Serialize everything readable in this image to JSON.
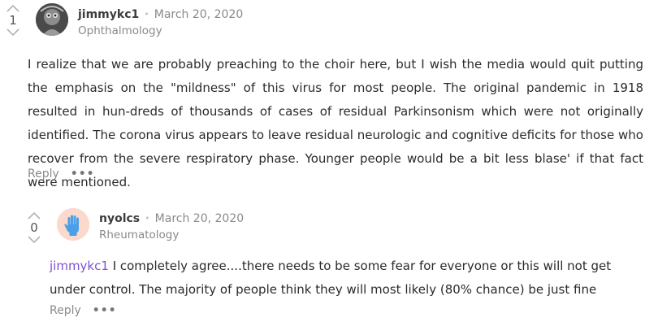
{
  "comments": [
    {
      "votes": "1",
      "author": "jimmykc1",
      "date": "March 20, 2020",
      "specialty": "Ophthalmology",
      "body": "I realize that we are probably preaching to the choir here, but I wish the media would quit putting the emphasis on the \"mildness\" of this virus for most people. The original pandemic in 1918 resulted in hun-dreds of thousands of cases of residual Parkinsonism which were not originally identified. The corona virus appears to leave residual neurologic and cognitive deficits for those who recover from the severe respiratory phase. Younger people would be a bit less blase' if that fact were mentioned.",
      "reply_label": "Reply",
      "more_label": "•••"
    },
    {
      "votes": "0",
      "author": "nyolcs",
      "date": "March 20, 2020",
      "specialty": "Rheumatology",
      "mention": "jimmykc1",
      "body": " I completely agree....there needs to be some fear for everyone or this will not get under control. The majority of people think they will most likely (80% chance) be just fine",
      "reply_label": "Reply",
      "more_label": "•••"
    }
  ],
  "separator": "•",
  "icons": {
    "upvote": "chevron-up-icon",
    "downvote": "chevron-down-icon",
    "avatar1": "avatar-photo",
    "avatar2": "glove-icon"
  },
  "colors": {
    "mention": "#7d4fd8",
    "avatar2_bg": "#fbd9cc",
    "glove": "#4a9fe8"
  }
}
